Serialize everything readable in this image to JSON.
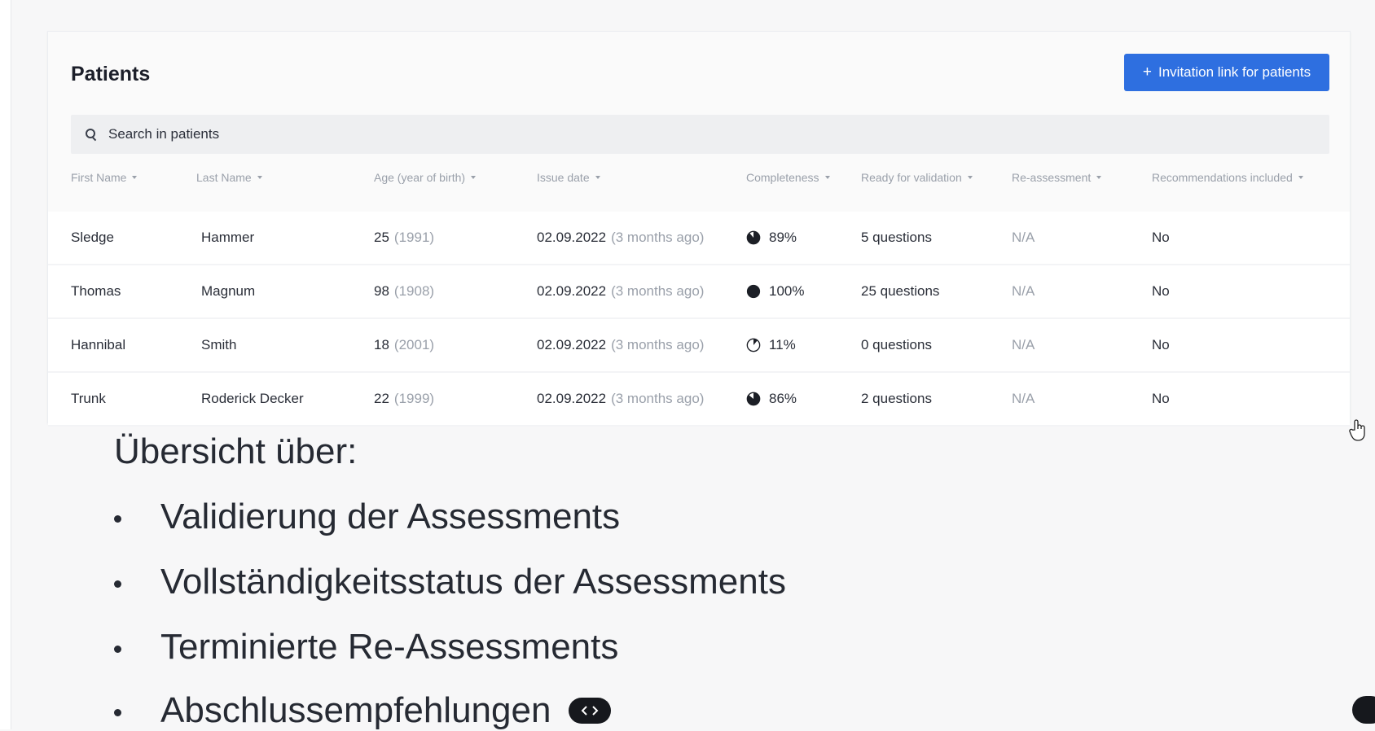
{
  "patients": {
    "title": "Patients",
    "invite_button_icon": "+",
    "invite_button_label": "Invitation link for patients",
    "search_placeholder": "Search in patients",
    "columns": [
      "First Name",
      "Last Name",
      "Age (year of birth)",
      "Issue date",
      "Completeness",
      "Ready for validation",
      "Re-assessment",
      "Recommendations included"
    ],
    "rows": [
      {
        "first": "Sledge",
        "last": "Hammer",
        "age": "25",
        "birth": "(1991)",
        "issue": "02.09.2022",
        "ago": "(3 months ago)",
        "completeness": "89%",
        "completeness_value": 0.89,
        "ready": "5 questions",
        "reassess": "N/A",
        "recommendations": "No"
      },
      {
        "first": "Thomas",
        "last": "Magnum",
        "age": "98",
        "birth": "(1908)",
        "issue": "02.09.2022",
        "ago": "(3 months ago)",
        "completeness": "100%",
        "completeness_value": 1.0,
        "ready": "25 questions",
        "reassess": "N/A",
        "recommendations": "No"
      },
      {
        "first": "Hannibal",
        "last": "Smith",
        "age": "18",
        "birth": "(2001)",
        "issue": "02.09.2022",
        "ago": "(3 months ago)",
        "completeness": "11%",
        "completeness_value": 0.11,
        "ready": "0 questions",
        "reassess": "N/A",
        "recommendations": "No"
      },
      {
        "first": "Trunk",
        "last": "Roderick Decker",
        "age": "22",
        "birth": "(1999)",
        "issue": "02.09.2022",
        "ago": "(3 months ago)",
        "completeness": "86%",
        "completeness_value": 0.86,
        "ready": "2 questions",
        "reassess": "N/A",
        "recommendations": "No"
      }
    ]
  },
  "slide": {
    "title": "Übersicht über:",
    "bullets": [
      "Validierung der Assessments",
      "Vollständigkeitsstatus der Assessments",
      "Terminierte Re-Assessments",
      "Abschlussempfehlungen"
    ]
  },
  "colors": {
    "accent": "#2e6fe0",
    "pie_fill": "#1c1f26"
  },
  "icons": [
    "search-icon",
    "plus-icon",
    "sort-caret-icon",
    "pie-progress-icon",
    "code-arrows-icon",
    "hand-cursor-icon"
  ]
}
